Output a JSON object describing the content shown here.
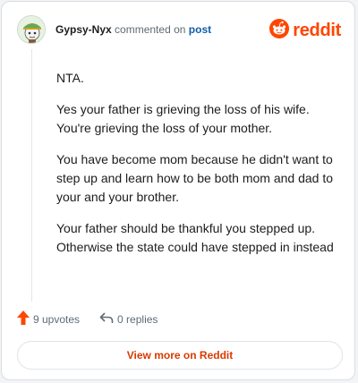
{
  "header": {
    "username": "Gypsy-Nyx",
    "action_text": "commented on",
    "post_link": "post",
    "avatar_icon": "snoo-avatar-icon"
  },
  "brand": {
    "icon": "reddit-logo-icon",
    "wordmark": "reddit",
    "color": "#ff4500"
  },
  "comment": {
    "paragraphs": [
      "NTA.",
      "Yes your father is grieving the loss of his wife. You're grieving the loss of your mother.",
      "You have become mom because he didn't want to step up and learn how to be both mom and dad to your and your brother.",
      "Your father should be thankful you stepped up. Otherwise the state could have stepped in instead"
    ]
  },
  "actions": {
    "upvotes": "9 upvotes",
    "replies": "0 replies",
    "upvote_color": "#ff4500"
  },
  "view_button": {
    "label": "View more on Reddit",
    "color": "#d93a00"
  }
}
